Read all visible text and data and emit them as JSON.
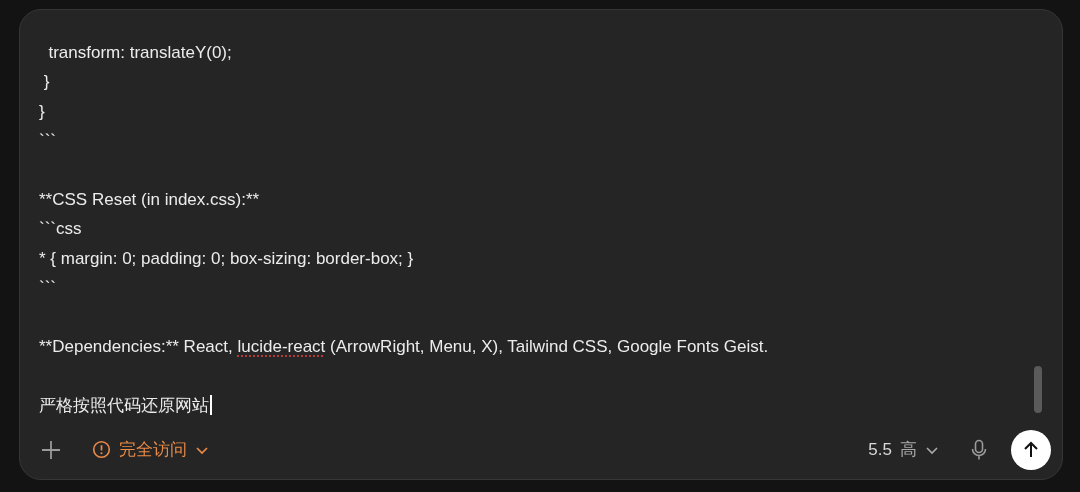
{
  "composer": {
    "blocks": [
      [
        "  transform: translateY(0);",
        " }",
        "}",
        "```"
      ],
      [
        "**CSS Reset (in index.css):**",
        "```css",
        "* { margin: 0; padding: 0; box-sizing: border-box; }",
        "```"
      ],
      [
        {
          "parts": [
            {
              "text": "**Dependencies:** React, ",
              "misspelled": false
            },
            {
              "text": "lucide-react",
              "misspelled": true
            },
            {
              "text": " (ArrowRight, Menu, X), Tailwind CSS, Google Fonts Geist.",
              "misspelled": false
            }
          ]
        }
      ],
      [
        "严格按照代码还原网站"
      ]
    ]
  },
  "toolbar": {
    "access": {
      "label": "完全访问"
    },
    "model": {
      "version": "5.5",
      "effort": "高"
    }
  }
}
